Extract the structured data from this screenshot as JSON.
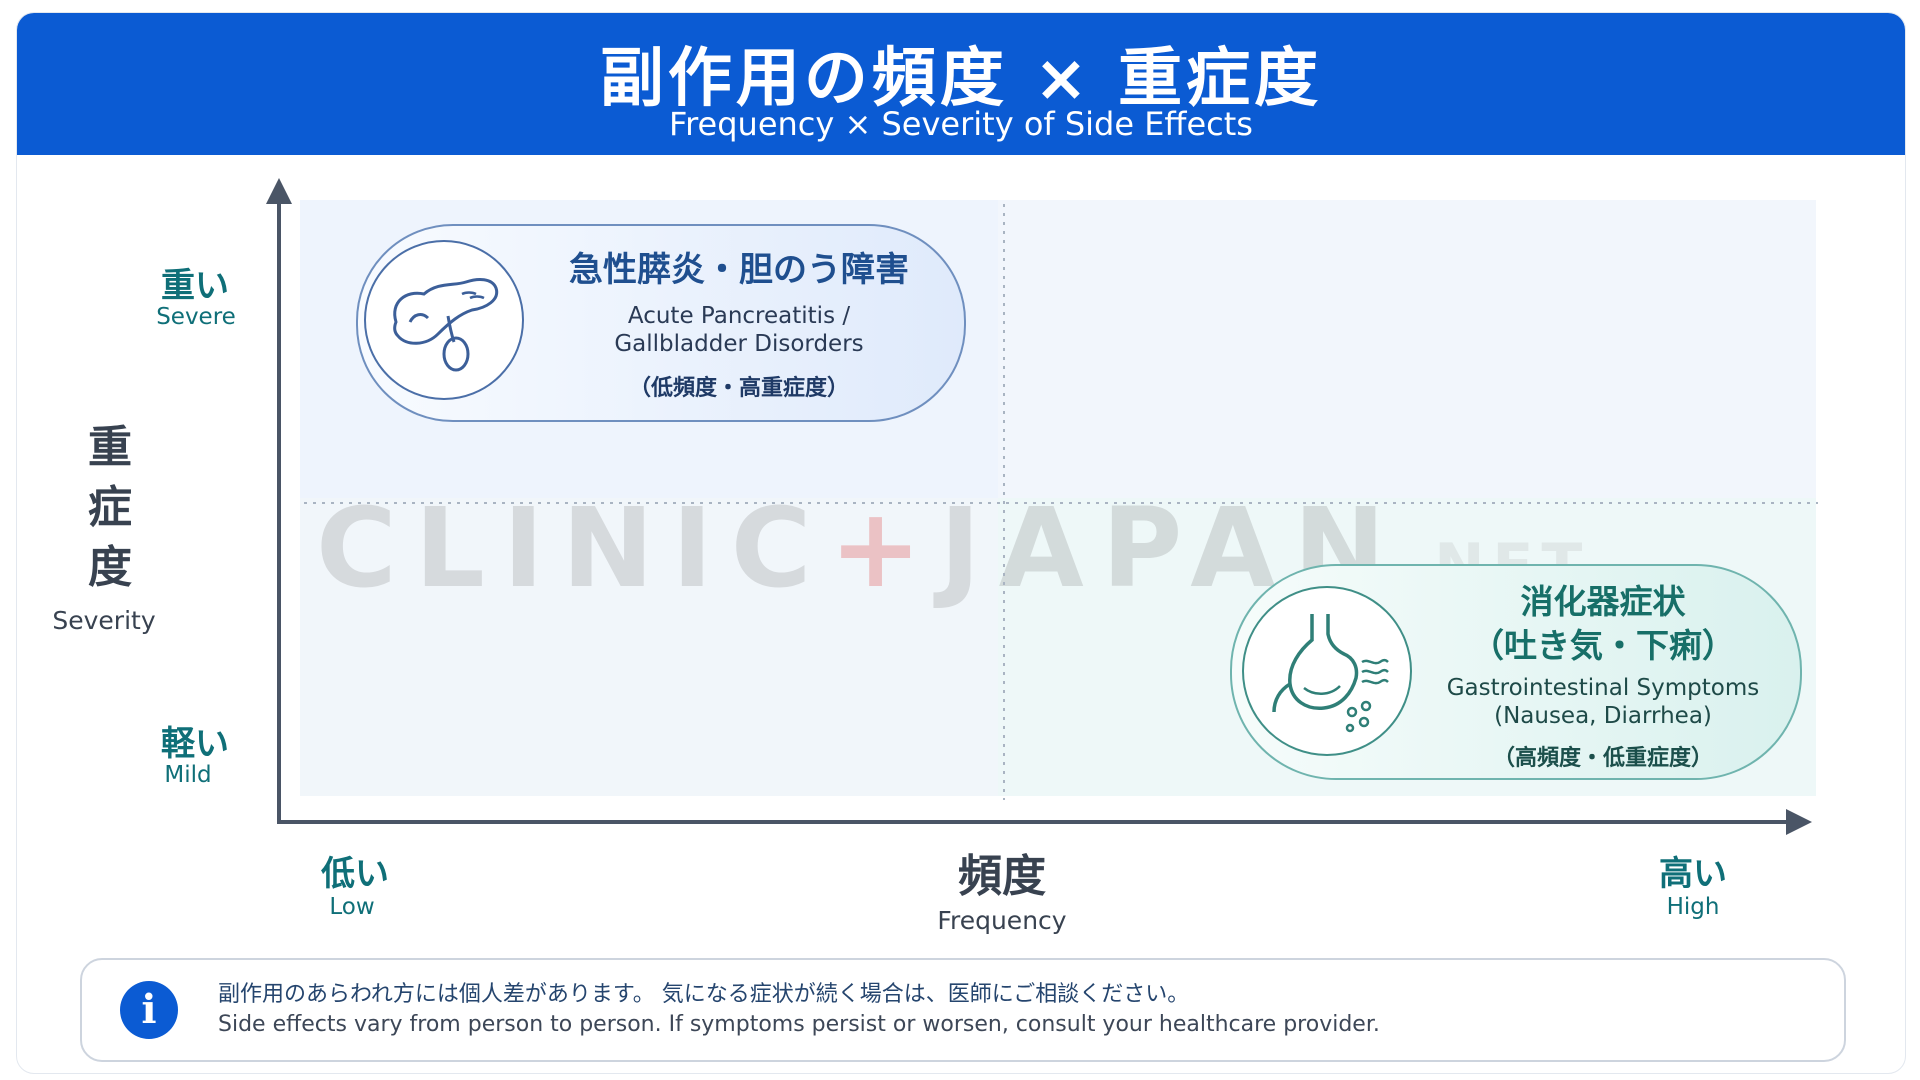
{
  "header": {
    "title": "副作用の頻度 × 重症度",
    "subtitle": "Frequency × Severity of Side Effects"
  },
  "y_axis": {
    "title_chars": [
      "重",
      "症",
      "度"
    ],
    "title_en": "Severity",
    "high_jp": "重い",
    "high_en": "Severe",
    "low_jp": "軽い",
    "low_en": "Mild"
  },
  "x_axis": {
    "title_jp": "頻度",
    "title_en": "Frequency",
    "low_jp": "低い",
    "low_en": "Low",
    "high_jp": "高い",
    "high_en": "High"
  },
  "watermark": {
    "left": "CLINIC",
    "plus": "+",
    "right": "JAPAN",
    "suffix": ".NET"
  },
  "items": [
    {
      "title_jp": "急性膵炎・胆のう障害",
      "title_en_line1": "Acute Pancreatitis /",
      "title_en_line2": "Gallbladder Disorders",
      "note": "（低頻度・高重症度）",
      "icon": "pancreas-gallbladder-icon",
      "color": "#1f4f8f"
    },
    {
      "title_jp_line1": "消化器症状",
      "title_jp_line2": "（吐き気・下痢）",
      "title_en_line1": "Gastrointestinal Symptoms",
      "title_en_line2": "(Nausea, Diarrhea)",
      "note": "（高頻度・低重症度）",
      "icon": "stomach-icon",
      "color": "#176f68"
    }
  ],
  "notice": {
    "icon": "info-icon",
    "icon_glyph": "i",
    "text_jp": "副作用のあらわれ方には個人差があります。 気になる症状が続く場合は、医師にご相談ください。",
    "text_en": "Side effects vary from person to person. If symptoms persist or worsen, consult your healthcare provider."
  },
  "colors": {
    "header_bg": "#0b5bd3",
    "severe_item": "#6f8fbf",
    "mild_item": "#6fb4ae",
    "axis": "#4a5566"
  }
}
